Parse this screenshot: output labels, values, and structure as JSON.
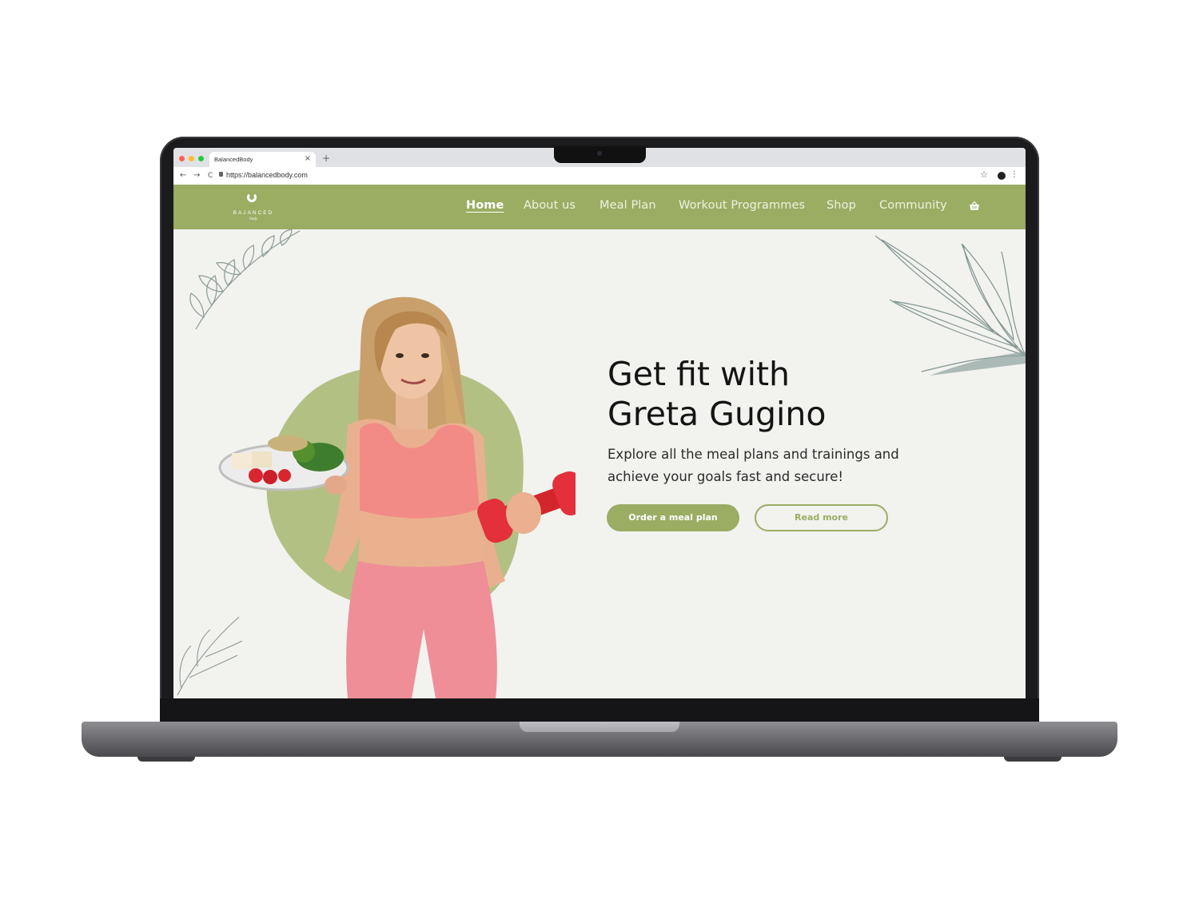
{
  "browser": {
    "tab_title": "BalancedBody",
    "tab_close": "×",
    "new_tab": "+",
    "url": "https://balancedbody.com",
    "nav_back": "←",
    "nav_forward": "→",
    "nav_reload": "C",
    "bookmark": "☆",
    "menu": "⋮"
  },
  "header": {
    "logo_text": "BAJANCED",
    "logo_sub": "body",
    "nav": [
      {
        "label": "Home",
        "active": true
      },
      {
        "label": "About us"
      },
      {
        "label": "Meal Plan"
      },
      {
        "label": "Workout Programmes"
      },
      {
        "label": "Shop"
      },
      {
        "label": "Community"
      }
    ],
    "cart_icon": "basket-icon"
  },
  "hero": {
    "title": "Get fit with\nGreta Gugino",
    "subtitle": "Explore all the meal plans and trainings and achieve your goals fast and secure!",
    "primary_button": "Order a meal plan",
    "secondary_button": "Read more"
  },
  "colors": {
    "brand_green": "#9bad63",
    "page_background": "#f2f2ef",
    "text_dark": "#141414"
  }
}
